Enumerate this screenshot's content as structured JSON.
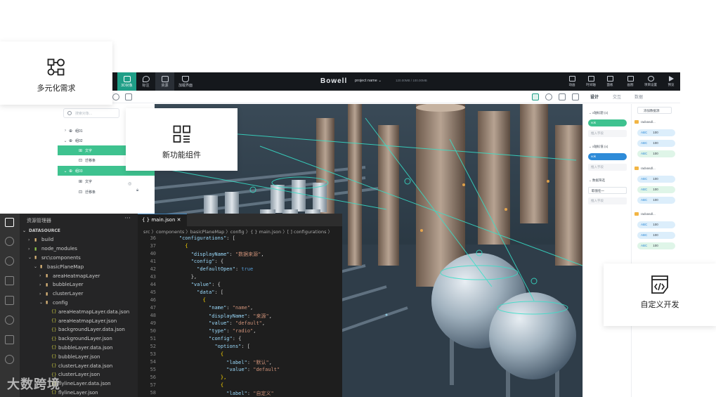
{
  "cards": {
    "diverse_needs": "多元化需求",
    "new_components": "新功能组件",
    "custom_dev": "自定义开发"
  },
  "editor": {
    "brand": "Bowell",
    "project_name": "project name ⌄",
    "memory": "120.00MB / 100.00MB",
    "left_tools": [
      "3D对象",
      "标注",
      "资源",
      "加载界面"
    ],
    "right_tools": [
      "动画",
      "时间轴",
      "面板",
      "画图",
      "项目设置",
      "预览"
    ],
    "right_tabs": [
      "设计",
      "交互",
      "数据"
    ]
  },
  "layer_tree": {
    "search_placeholder": "搜索对象...",
    "rows": [
      {
        "label": "组01",
        "chev": "›",
        "glyph": "⊕",
        "selected": false,
        "indent": 0
      },
      {
        "label": "组02",
        "chev": "⌄",
        "glyph": "⊕",
        "selected": false,
        "indent": 0
      },
      {
        "label": "文字",
        "chev": "",
        "glyph": "⊞",
        "selected": true,
        "indent": 1
      },
      {
        "label": "迁移条",
        "chev": "",
        "glyph": "⊡",
        "selected": false,
        "indent": 1
      },
      {
        "label": "组03",
        "chev": "⌄",
        "glyph": "⊕",
        "selected": true,
        "indent": 0
      },
      {
        "label": "文字",
        "chev": "",
        "glyph": "⊞",
        "selected": false,
        "indent": 1
      },
      {
        "label": "迁移条",
        "chev": "",
        "glyph": "⊡",
        "selected": false,
        "indent": 1
      }
    ]
  },
  "props": {
    "x_axis_label": "⌄ x轴标题 (x)",
    "x_value": "vok",
    "x_input": "推入字段",
    "y_axis_label": "⌄ x轴标值 (x)",
    "y_value": "vok",
    "y_input": "推入字段",
    "filter_label": "⌄ 数据筛选",
    "filter_select": "取值任一",
    "filter_input": "推入字段"
  },
  "data_panel": {
    "add_source": "添加数据源",
    "folders": [
      "radvasdl...",
      "radvasdl...",
      "radvasdl..."
    ],
    "chip_key": "ABC",
    "chip_value": "100"
  },
  "vscode": {
    "explorer_title": "资源管理器",
    "tab_label": "{ } main.json  ✕",
    "breadcrumb": "src 〉components 〉basicPlaneMap 〉config 〉{ } main.json 〉[ ] configurations 〉",
    "tree": [
      {
        "label": "DATASOURCE",
        "tw": "⌄",
        "icon": "",
        "cls": "",
        "indent": 0
      },
      {
        "label": "build",
        "tw": "›",
        "icon": "▮",
        "cls": "folder",
        "indent": 1
      },
      {
        "label": "node_modules",
        "tw": "›",
        "icon": "▮",
        "cls": "node",
        "indent": 1
      },
      {
        "label": "src\\components",
        "tw": "⌄",
        "icon": "▮",
        "cls": "folder",
        "indent": 1
      },
      {
        "label": "basicPlaneMap",
        "tw": "⌄",
        "icon": "▮",
        "cls": "folder",
        "indent": 2
      },
      {
        "label": "areaHeatmapLayer",
        "tw": "›",
        "icon": "▮",
        "cls": "folder",
        "indent": 3
      },
      {
        "label": "bubbleLayer",
        "tw": "›",
        "icon": "▮",
        "cls": "folder",
        "indent": 3
      },
      {
        "label": "clusterLayer",
        "tw": "›",
        "icon": "▮",
        "cls": "folder",
        "indent": 3
      },
      {
        "label": "config",
        "tw": "⌄",
        "icon": "▮",
        "cls": "folder",
        "indent": 3
      },
      {
        "label": "areaHeatmapLayer.data.json",
        "tw": "",
        "icon": "{}",
        "cls": "json",
        "indent": 4
      },
      {
        "label": "areaHeatmapLayer.json",
        "tw": "",
        "icon": "{}",
        "cls": "json",
        "indent": 4
      },
      {
        "label": "backgroundLayer.data.json",
        "tw": "",
        "icon": "{}",
        "cls": "json",
        "indent": 4
      },
      {
        "label": "backgroundLayer.json",
        "tw": "",
        "icon": "{}",
        "cls": "json",
        "indent": 4
      },
      {
        "label": "bubbleLayer.data.json",
        "tw": "",
        "icon": "{}",
        "cls": "json",
        "indent": 4
      },
      {
        "label": "bubbleLayer.json",
        "tw": "",
        "icon": "{}",
        "cls": "json",
        "indent": 4
      },
      {
        "label": "clusterLayer.data.json",
        "tw": "",
        "icon": "{}",
        "cls": "json",
        "indent": 4
      },
      {
        "label": "clusterLayer.json",
        "tw": "",
        "icon": "{}",
        "cls": "json",
        "indent": 4
      },
      {
        "label": "flylineLayer.data.json",
        "tw": "",
        "icon": "{}",
        "cls": "json",
        "indent": 4
      },
      {
        "label": "flylineLayer.json",
        "tw": "",
        "icon": "{}",
        "cls": "json",
        "indent": 4
      }
    ],
    "code": [
      {
        "n": "36",
        "t": [
          [
            "    ",
            "p"
          ],
          [
            "\"configurations\"",
            "key"
          ],
          [
            ": [",
            "p"
          ]
        ]
      },
      {
        "n": "37",
        "t": [
          [
            "      {",
            "br"
          ]
        ]
      },
      {
        "n": "40",
        "t": [
          [
            "        ",
            "p"
          ],
          [
            "\"displayName\"",
            "key"
          ],
          [
            ": ",
            "p"
          ],
          [
            "\"数据来源\"",
            "str"
          ],
          [
            ",",
            "p"
          ]
        ]
      },
      {
        "n": "41",
        "t": [
          [
            "        ",
            "p"
          ],
          [
            "\"config\"",
            "key"
          ],
          [
            ": {",
            "p"
          ]
        ]
      },
      {
        "n": "42",
        "t": [
          [
            "          ",
            "p"
          ],
          [
            "\"defaultOpen\"",
            "key"
          ],
          [
            ": ",
            "p"
          ],
          [
            "true",
            "kw"
          ]
        ]
      },
      {
        "n": "43",
        "t": [
          [
            "        },",
            "p"
          ]
        ]
      },
      {
        "n": "44",
        "t": [
          [
            "        ",
            "p"
          ],
          [
            "\"value\"",
            "key"
          ],
          [
            ": {",
            "p"
          ]
        ]
      },
      {
        "n": "45",
        "t": [
          [
            "          ",
            "p"
          ],
          [
            "\"data\"",
            "key"
          ],
          [
            ": [",
            "p"
          ]
        ]
      },
      {
        "n": "46",
        "t": [
          [
            "            {",
            "br"
          ]
        ]
      },
      {
        "n": "47",
        "t": [
          [
            "              ",
            "p"
          ],
          [
            "\"name\"",
            "key"
          ],
          [
            ": ",
            "p"
          ],
          [
            "\"name\"",
            "str"
          ],
          [
            ",",
            "p"
          ]
        ]
      },
      {
        "n": "48",
        "t": [
          [
            "              ",
            "p"
          ],
          [
            "\"displayName\"",
            "key"
          ],
          [
            ": ",
            "p"
          ],
          [
            "\"来源\"",
            "str"
          ],
          [
            ",",
            "p"
          ]
        ]
      },
      {
        "n": "49",
        "t": [
          [
            "              ",
            "p"
          ],
          [
            "\"value\"",
            "key"
          ],
          [
            ": ",
            "p"
          ],
          [
            "\"default\"",
            "str"
          ],
          [
            ",",
            "p"
          ]
        ]
      },
      {
        "n": "50",
        "t": [
          [
            "              ",
            "p"
          ],
          [
            "\"type\"",
            "key"
          ],
          [
            ": ",
            "p"
          ],
          [
            "\"radio\"",
            "str"
          ],
          [
            ",",
            "p"
          ]
        ]
      },
      {
        "n": "51",
        "t": [
          [
            "              ",
            "p"
          ],
          [
            "\"config\"",
            "key"
          ],
          [
            ": {",
            "p"
          ]
        ]
      },
      {
        "n": "52",
        "t": [
          [
            "                ",
            "p"
          ],
          [
            "\"options\"",
            "key"
          ],
          [
            ": [",
            "p"
          ]
        ]
      },
      {
        "n": "53",
        "t": [
          [
            "                  {",
            "br"
          ]
        ]
      },
      {
        "n": "54",
        "t": [
          [
            "                    ",
            "p"
          ],
          [
            "\"label\"",
            "key"
          ],
          [
            ": ",
            "p"
          ],
          [
            "\"默认\"",
            "str"
          ],
          [
            ",",
            "p"
          ]
        ]
      },
      {
        "n": "55",
        "t": [
          [
            "                    ",
            "p"
          ],
          [
            "\"value\"",
            "key"
          ],
          [
            ": ",
            "p"
          ],
          [
            "\"default\"",
            "str"
          ]
        ]
      },
      {
        "n": "56",
        "t": [
          [
            "                  },",
            "br"
          ]
        ]
      },
      {
        "n": "57",
        "t": [
          [
            "                  {",
            "br"
          ]
        ]
      },
      {
        "n": "58",
        "t": [
          [
            "                    ",
            "p"
          ],
          [
            "\"label\"",
            "key"
          ],
          [
            ": ",
            "p"
          ],
          [
            "\"自定义\"",
            "str"
          ]
        ]
      }
    ]
  },
  "watermark": "大数跨境",
  "colors": {
    "accent_green": "#3ec28f",
    "toolbar_teal": "#1f9e87",
    "blue": "#2e8bd8"
  }
}
